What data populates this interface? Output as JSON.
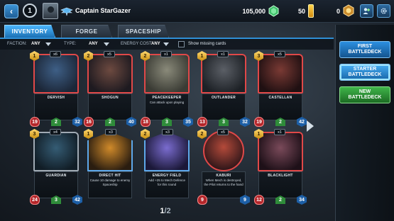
{
  "topbar": {
    "back_icon": "chevron-left-icon",
    "level": "1",
    "player_name": "Captain StarGazer",
    "credits": "105,000",
    "energy": "50",
    "tokens": "0"
  },
  "tabs": [
    {
      "label": "INVENTORY",
      "active": true
    },
    {
      "label": "FORGE",
      "active": false
    },
    {
      "label": "SPACESHIP",
      "active": false
    }
  ],
  "filters": {
    "faction_label": "FACTION:",
    "faction_value": "ANY",
    "type_label": "TYPE:",
    "type_value": "ANY",
    "energy_label": "ENERGY COST:",
    "energy_value": "ANY",
    "missing_label": "Show missing cards",
    "missing_checked": false
  },
  "cards": [
    {
      "name": "DERVISH",
      "cost": "1",
      "count": "x6",
      "ability": "",
      "atk": "19",
      "mid": "2",
      "hp": "32",
      "frame": "red",
      "palette": [
        "#3e5f86",
        "#1c2738"
      ]
    },
    {
      "name": "SHOGUN",
      "cost": "2",
      "count": "x5",
      "ability": "",
      "atk": "16",
      "mid": "2",
      "hp": "40",
      "frame": "red",
      "palette": [
        "#6d4a40",
        "#1e1a20"
      ]
    },
    {
      "name": "PEACEKEEPER",
      "cost": "2",
      "count": "x1",
      "ability": "Can attack upon playing",
      "atk": "18",
      "mid": "3",
      "hp": "35",
      "frame": "red",
      "palette": [
        "#8a8a7a",
        "#3a3b34"
      ]
    },
    {
      "name": "OUTLANDER",
      "cost": "1",
      "count": "x1",
      "ability": "",
      "atk": "13",
      "mid": "3",
      "hp": "32",
      "frame": "red",
      "palette": [
        "#5b5f66",
        "#1d2126"
      ]
    },
    {
      "name": "CASTELLAN",
      "cost": "3",
      "count": "x5",
      "ability": "",
      "atk": "19",
      "mid": "2",
      "hp": "42",
      "frame": "red",
      "palette": [
        "#7a3a34",
        "#201012"
      ]
    },
    {
      "name": "GUARDIAN",
      "cost": "3",
      "count": "x4",
      "ability": "",
      "atk": "24",
      "mid": "3",
      "hp": "42",
      "frame": "gray",
      "palette": [
        "#355c74",
        "#111d26"
      ]
    },
    {
      "name": "DIRECT HIT",
      "cost": "1",
      "count": "x3",
      "ability": "Cause 10 damage to enemy Spaceship",
      "atk": "",
      "mid": "",
      "hp": "",
      "frame": "hex",
      "palette": [
        "#d08a2a",
        "#2a1d10"
      ]
    },
    {
      "name": "ENERGY FIELD",
      "cost": "2",
      "count": "x3",
      "ability": "Add +25 to Mech Defence for this round",
      "atk": "",
      "mid": "",
      "hp": "",
      "frame": "hex",
      "palette": [
        "#7a6ccf",
        "#1b1838"
      ]
    },
    {
      "name": "KABURI",
      "cost": "2",
      "count": "x5",
      "ability": "When Mech is destroyed, the Pilot returns to the hand",
      "atk": "9",
      "mid": "",
      "hp": "9",
      "frame": "circle",
      "palette": [
        "#b44a3a",
        "#2a1418"
      ]
    },
    {
      "name": "BLACKLIGHT",
      "cost": "1",
      "count": "x1",
      "ability": "",
      "atk": "12",
      "mid": "2",
      "hp": "34",
      "frame": "red",
      "palette": [
        "#7a4a5a",
        "#1e1018"
      ]
    }
  ],
  "pager": {
    "current": "1",
    "separator": "/",
    "total": "2"
  },
  "side_panel": {
    "first_deck": "FIRST BATTLEDECK",
    "starter_deck": "STARTER BATTLEDECK",
    "new_deck": "NEW BATTLEDECK"
  }
}
